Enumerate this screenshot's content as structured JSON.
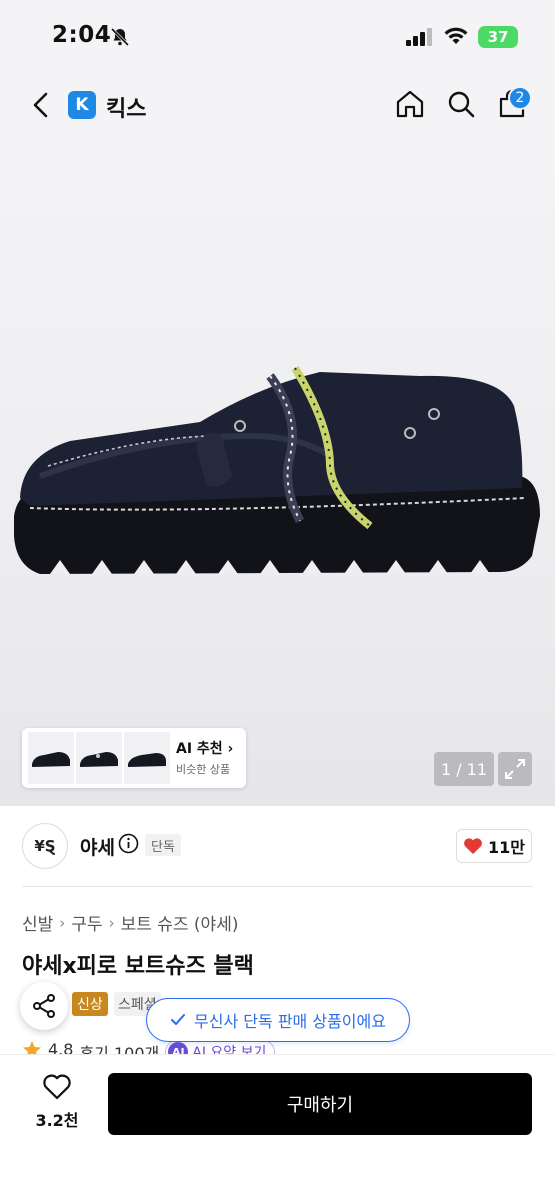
{
  "status": {
    "time": "2:04",
    "battery": "37"
  },
  "header": {
    "brand_logo_letter": "K",
    "brand_name": "킥스",
    "cart_count": "2"
  },
  "gallery": {
    "counter": "1 / 11",
    "ai_recommend": {
      "title": "AI 추천 ›",
      "subtitle": "비슷한 상품"
    }
  },
  "brand": {
    "logo_text": "¥Ȿ",
    "name": "야세",
    "exclusive_chip": "단독",
    "likes": "11만"
  },
  "breadcrumb": {
    "items": [
      "신발",
      "구두",
      "보트 슈즈 (야세)"
    ],
    "separator": "›"
  },
  "product": {
    "title": "야세x피로 보트슈즈 블랙",
    "tags": {
      "new": "신상",
      "special": "스페셜"
    },
    "rating": "4.8",
    "reviews": "후기 100개",
    "ai_summary": {
      "badge": "AI",
      "label": "AI 요약 보기"
    }
  },
  "toast": {
    "text": "무신사 단독 판매 상품이에요"
  },
  "bottom_bar": {
    "wish_count": "3.2천",
    "buy_label": "구매하기"
  },
  "colors": {
    "accent_blue": "#2b6cf0",
    "new_tag": "#c8871f",
    "heart_red": "#e53935",
    "ai_purple": "#6a4bd8"
  },
  "icons": [
    "bell-slash-icon",
    "signal-icon",
    "wifi-icon",
    "back-arrow-icon",
    "home-icon",
    "search-icon",
    "shopping-bag-icon",
    "expand-icon",
    "info-icon",
    "heart-icon",
    "share-icon",
    "check-icon",
    "star-icon"
  ]
}
